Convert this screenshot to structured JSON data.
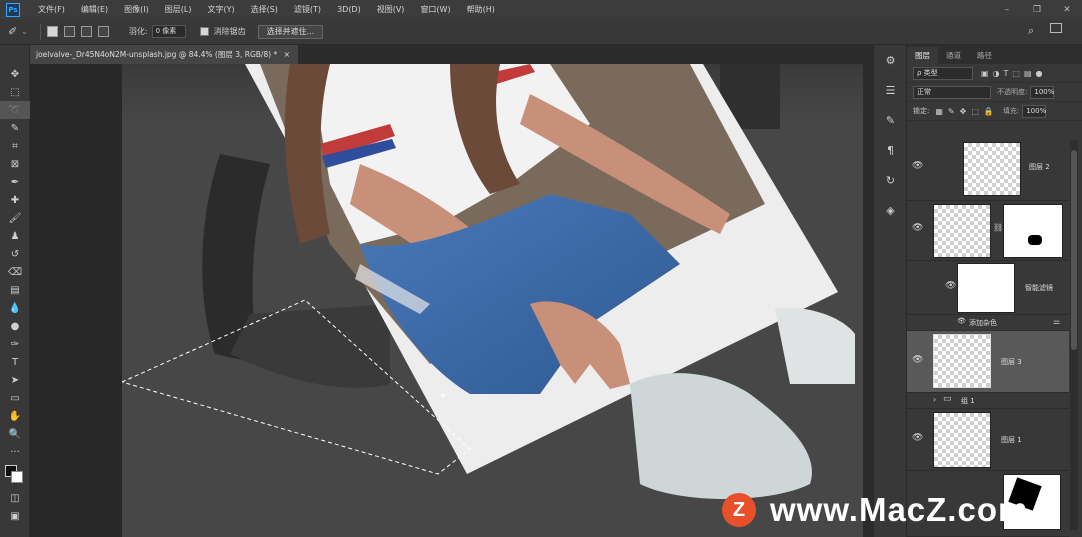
{
  "app": {
    "logo_text": "Ps"
  },
  "menu": [
    "文件(F)",
    "编辑(E)",
    "图像(I)",
    "图层(L)",
    "文字(Y)",
    "选择(S)",
    "滤镜(T)",
    "3D(D)",
    "视图(V)",
    "窗口(W)",
    "帮助(H)"
  ],
  "window_controls": {
    "minimize": "–",
    "restore": "❐",
    "close": "✕"
  },
  "options": {
    "feather_label": "羽化:",
    "feather_value": "0 像素",
    "antialias_label": "消除锯齿",
    "select_mask_button": "选择并遮住..."
  },
  "document": {
    "tab_title": "joelvalve-_Dr45N4oN2M-unsplash.jpg @ 84.4% (图层 3, RGB/8) *",
    "close_glyph": "×"
  },
  "layers_panel": {
    "tabs": [
      "图层",
      "通道",
      "路径"
    ],
    "filter_label": "ρ 类型",
    "blend_mode": "正常",
    "opacity_label": "不透明度:",
    "opacity_value": "100%",
    "lock_label": "锁定:",
    "fill_label": "填充:",
    "fill_value": "100%",
    "layers": [
      {
        "name": "图层 2"
      },
      {
        "name": ""
      },
      {
        "name": "智能滤镜"
      },
      {
        "name": "添加杂色"
      },
      {
        "name": "图层 3"
      },
      {
        "name": "组 1"
      },
      {
        "name": "图层 1"
      }
    ]
  },
  "watermark": {
    "logo": "Z",
    "text": "www.MacZ.com"
  },
  "colors": {
    "accent": "#31a8ff",
    "watermark": "#e8502b"
  }
}
